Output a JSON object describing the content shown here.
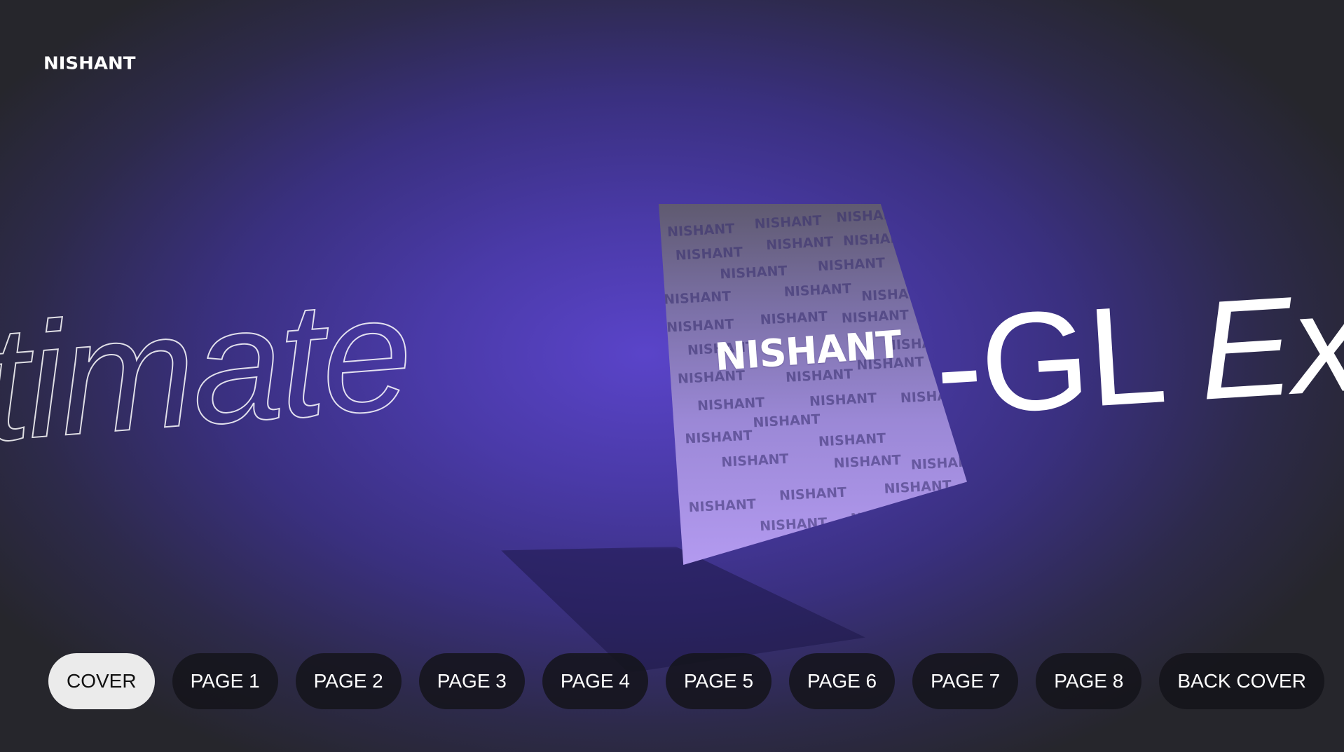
{
  "brand": {
    "logo_text": "NISHANT"
  },
  "hero": {
    "outline_text": "ltimate",
    "solid_text": "-GL",
    "solid_italic_text": "Ex"
  },
  "book": {
    "cover_logo": "NISHANT",
    "pattern_word": "NISHANT"
  },
  "nav": {
    "items": [
      {
        "label": "COVER",
        "active": true
      },
      {
        "label": "PAGE 1",
        "active": false
      },
      {
        "label": "PAGE 2",
        "active": false
      },
      {
        "label": "PAGE 3",
        "active": false
      },
      {
        "label": "PAGE 4",
        "active": false
      },
      {
        "label": "PAGE 5",
        "active": false
      },
      {
        "label": "PAGE 6",
        "active": false
      },
      {
        "label": "PAGE 7",
        "active": false
      },
      {
        "label": "PAGE 8",
        "active": false
      },
      {
        "label": "BACK COVER",
        "active": false
      }
    ]
  },
  "colors": {
    "accent": "#5a44c9",
    "active_button_bg": "#ebebeb",
    "button_bg": "#14141a"
  }
}
